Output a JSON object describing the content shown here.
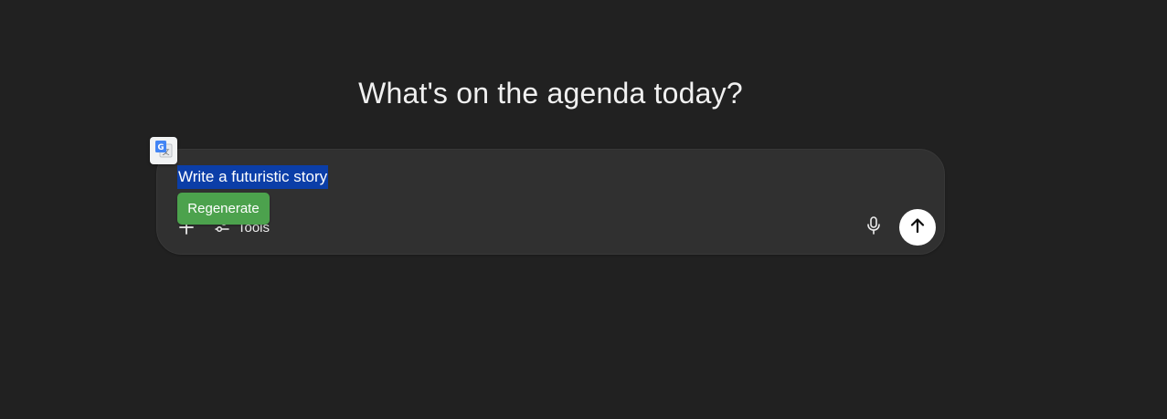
{
  "heading": "What's on the agenda today?",
  "composer": {
    "prompt_text": "Write a futuristic story",
    "tools_label": "Tools",
    "icons": {
      "attach": "plus-icon",
      "tools": "sliders-icon",
      "voice": "microphone-icon",
      "send": "arrow-up-icon",
      "translate": "google-translate-icon"
    }
  },
  "overlay": {
    "regenerate_label": "Regenerate",
    "regenerate_color": "#4ca24d"
  },
  "colors": {
    "background": "#212121",
    "composer": "#303030",
    "selection": "#0b3ea8"
  }
}
